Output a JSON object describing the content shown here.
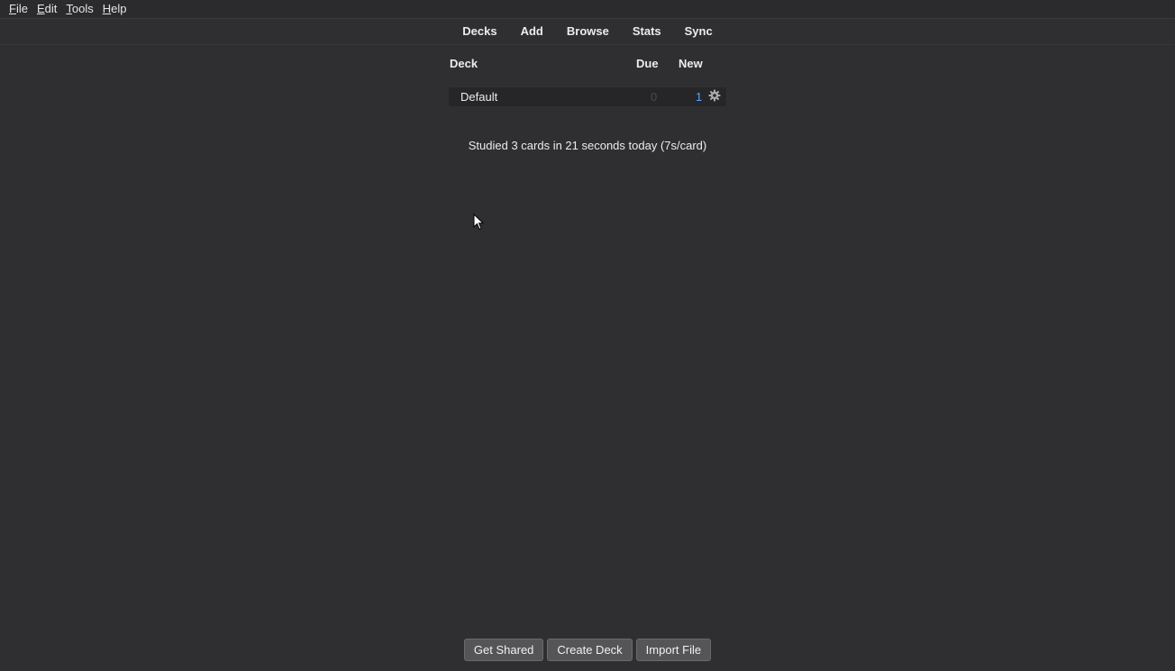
{
  "menubar": {
    "items": [
      {
        "mnemonic": "F",
        "rest": "ile"
      },
      {
        "mnemonic": "E",
        "rest": "dit"
      },
      {
        "mnemonic": "T",
        "rest": "ools"
      },
      {
        "mnemonic": "H",
        "rest": "elp"
      }
    ]
  },
  "toolbar": {
    "decks": "Decks",
    "add": "Add",
    "browse": "Browse",
    "stats": "Stats",
    "sync": "Sync"
  },
  "deck_table": {
    "headers": {
      "deck": "Deck",
      "due": "Due",
      "new": "New"
    },
    "rows": [
      {
        "name": "Default",
        "due": "0",
        "new": "1",
        "options_icon": "gear-icon"
      }
    ]
  },
  "studied_text": "Studied 3 cards in 21 seconds today (7s/card)",
  "bottom_buttons": {
    "get_shared": "Get Shared",
    "create_deck": "Create Deck",
    "import_file": "Import File"
  },
  "colors": {
    "background": "#2f2f31",
    "new_count": "#5aa3ff",
    "due_zero": "#4a4a4d",
    "button_bg": "#555558"
  }
}
